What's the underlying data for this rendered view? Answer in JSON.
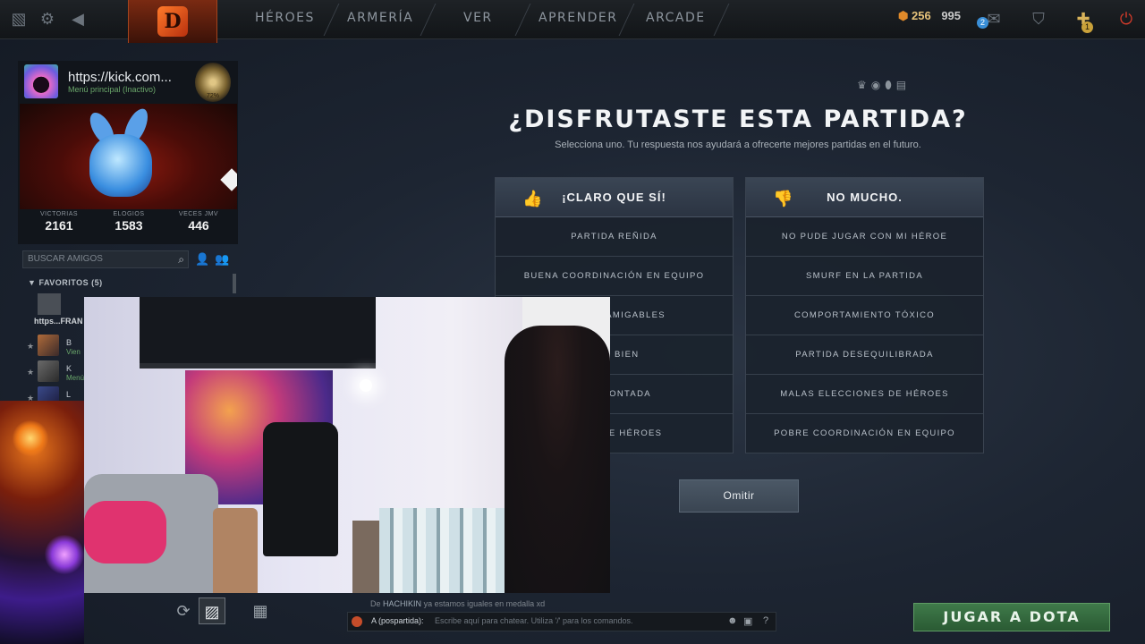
{
  "topbar": {
    "nav": [
      "HÉROES",
      "ARMERÍA",
      "VER",
      "APRENDER",
      "ARCADE"
    ],
    "currency_primary": "256",
    "currency_secondary": "995",
    "notifications_count": "2",
    "shards_count": "1"
  },
  "profile": {
    "name": "https://kick.com...",
    "status": "Menú principal (Inactivo)",
    "rank_pct": "72%",
    "stats": [
      {
        "label": "VICTORIAS",
        "value": "2161"
      },
      {
        "label": "ELOGIOS",
        "value": "1583"
      },
      {
        "label": "VECES JMV",
        "value": "446"
      }
    ]
  },
  "friends": {
    "search_placeholder": "BUSCAR AMIGOS",
    "favorites_header": "FAVORITOS (5)",
    "first": "https...FRAN",
    "rows": [
      {
        "name": "B",
        "status": "Vien"
      },
      {
        "name": "K",
        "status": "Menú"
      },
      {
        "name": "L",
        "status": ""
      }
    ]
  },
  "survey": {
    "title": "¿DISFRUTASTE ESTA PARTIDA?",
    "subtitle": "Selecciona uno. Tu respuesta nos ayudará a ofrecerte mejores partidas en el futuro.",
    "positive": {
      "header": "¡CLARO QUE SÍ!",
      "options": [
        "PARTIDA REÑIDA",
        "BUENA COORDINACIÓN EN EQUIPO",
        "EQUIPO AMIGABLES",
        "ADO BIEN",
        "A REMONTADA",
        "IONES DE HÉROES"
      ]
    },
    "negative": {
      "header": "NO MUCHO.",
      "options": [
        "NO PUDE JUGAR CON MI HÉROE",
        "SMURF EN LA PARTIDA",
        "COMPORTAMIENTO TÓXICO",
        "PARTIDA DESEQUILIBRADA",
        "MALAS ELECCIONES DE HÉROES",
        "POBRE COORDINACIÓN EN EQUIPO"
      ]
    },
    "skip_label": "Omitir"
  },
  "chat": {
    "last_prefix": "De",
    "last_author": "HACHIKIN",
    "last_text": "ya estamos iguales en medalla xd",
    "channel": "A (pospartida):",
    "placeholder": "Escribe aquí para chatear. Utiliza '/' para los comandos."
  },
  "play_button": "JUGAR A DOTA"
}
